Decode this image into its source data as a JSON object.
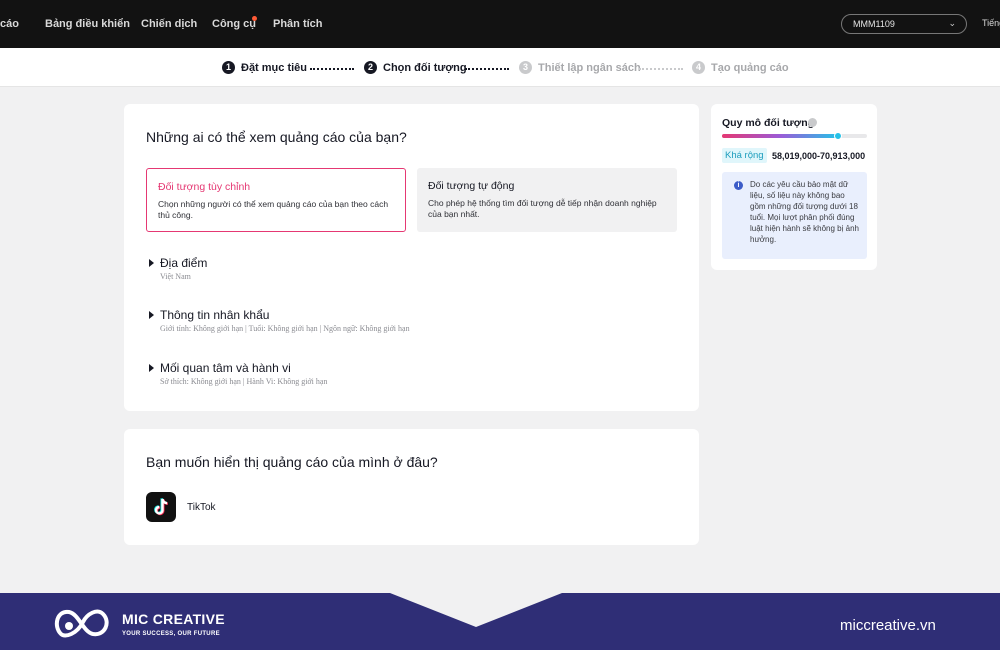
{
  "topnav": {
    "items": [
      "cáo",
      "Bảng điều khiển",
      "Chiến dịch",
      "Công cụ",
      "Phân tích"
    ],
    "account": "MMM1109",
    "language": "Tiếng"
  },
  "stepper": {
    "steps": [
      {
        "num": "1",
        "label": "Đặt mục tiêu"
      },
      {
        "num": "2",
        "label": "Chọn đối tượng"
      },
      {
        "num": "3",
        "label": "Thiết lập ngân sách"
      },
      {
        "num": "4",
        "label": "Tạo quảng cáo"
      }
    ]
  },
  "audience": {
    "heading": "Những ai có thể xem quảng cáo của bạn?",
    "options": [
      {
        "title": "Đối tượng tùy chỉnh",
        "desc": "Chọn những người có thể xem quảng cáo của bạn theo cách thủ công."
      },
      {
        "title": "Đối tượng tự động",
        "desc": "Cho phép hệ thống tìm đối tượng dễ tiếp nhận doanh nghiệp của bạn nhất."
      }
    ],
    "sections": [
      {
        "title": "Địa điểm",
        "sub": "Việt Nam"
      },
      {
        "title": "Thông tin nhân khẩu",
        "sub": "Giới tính: Không giới hạn | Tuổi: Không giới hạn | Ngôn ngữ: Không giới hạn"
      },
      {
        "title": "Mối quan tâm và hành vi",
        "sub": "Sở thích: Không giới hạn | Hành Vi: Không giới hạn"
      }
    ]
  },
  "placement": {
    "heading": "Bạn muốn hiển thị quảng cáo của mình ở đâu?",
    "platform": "TikTok"
  },
  "audience_size": {
    "title": "Quy mô đối tượng",
    "level": 0.8,
    "breadth": "Khá rộng",
    "range": "58,019,000-70,913,000",
    "notice": "Do các yêu cầu bảo mật dữ liệu, số liệu này không bao gồm những đối tượng dưới 18 tuổi. Mọi lượt phân phối đúng luật hiện hành sẽ không bị ảnh hưởng."
  },
  "footer": {
    "brand": "MIC CREATIVE",
    "tagline": "YOUR SUCCESS, OUR FUTURE",
    "site": "miccreative.vn"
  },
  "colors": {
    "accent": "#e53873",
    "footer_bg": "#2f2e76",
    "nav_bg": "#121212"
  }
}
